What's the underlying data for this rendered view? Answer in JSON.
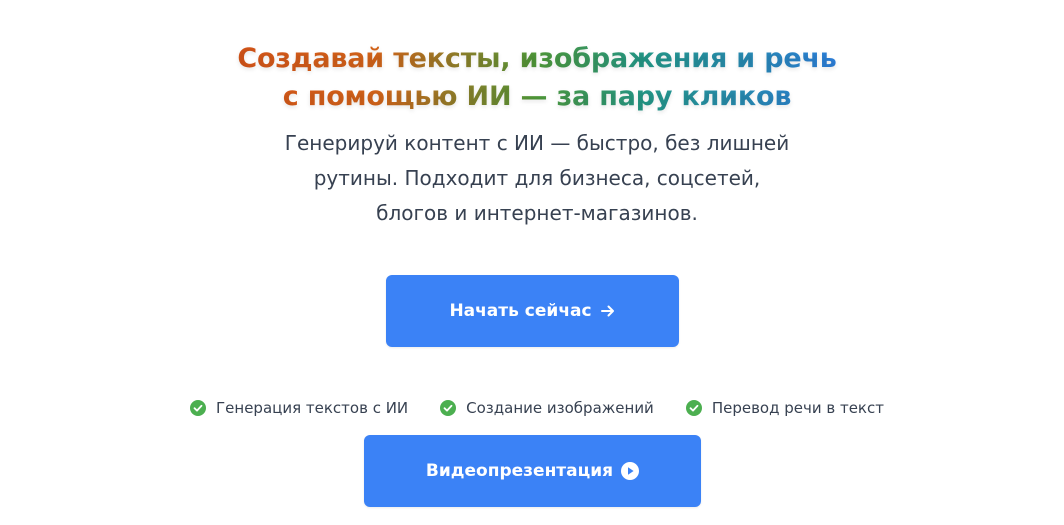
{
  "hero": {
    "headline_line1": "Создавай тексты, изображения и речь",
    "headline_line2": "с помощью ИИ — за пару кликов",
    "subtitle_line1": "Генерируй контент с ИИ — быстро, без лишней",
    "subtitle_line2": "рутины. Подходит для бизнеса, соцсетей,",
    "subtitle_line3": "блогов и интернет-магазинов."
  },
  "buttons": {
    "start_label": "Начать сейчас",
    "start_icon": "arrow-right-icon",
    "video_label": "Видеопрезентация",
    "video_icon": "play-circle-icon"
  },
  "features": [
    {
      "label": "Генерация текстов с ИИ",
      "icon": "check-circle-icon"
    },
    {
      "label": "Создание изображений",
      "icon": "check-circle-icon"
    },
    {
      "label": "Перевод речи в текст",
      "icon": "check-circle-icon"
    }
  ],
  "colors": {
    "accent": "#3b82f6",
    "check": "#4caf50",
    "text": "#374151",
    "headline_gradient_start": "#d63a17",
    "headline_gradient_mid": "#4f9a3a",
    "headline_gradient_end": "#3b82f6"
  }
}
